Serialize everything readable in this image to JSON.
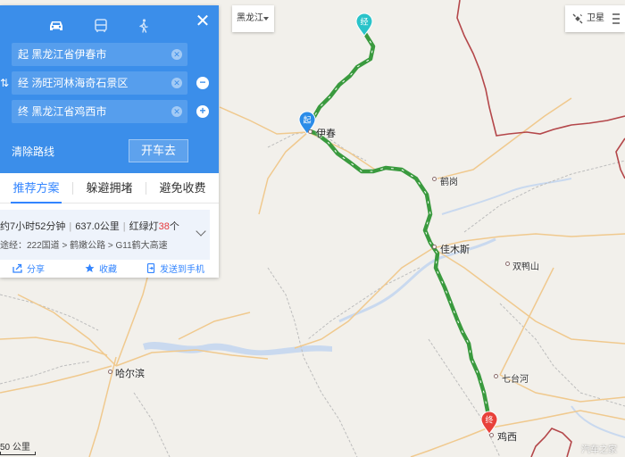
{
  "route_panel": {
    "modes": [
      {
        "name": "car-icon",
        "active": true
      },
      {
        "name": "bus-icon",
        "active": false
      },
      {
        "name": "walk-icon",
        "active": false
      }
    ],
    "start_field": "起  黑龙江省伊春市",
    "waypoint_field": "经  汤旺河林海奇石景区",
    "end_field": "终  黑龙江省鸡西市",
    "clear_route": "清除路线",
    "drive_button": "开车去",
    "tabs": [
      "推荐方案",
      "躲避拥堵",
      "避免收费"
    ],
    "summary": {
      "duration": "约7小时52分钟",
      "distance": "637.0公里",
      "lights_prefix": "红绿灯",
      "lights_count": "38",
      "lights_suffix": "个",
      "via": "途经：222国道 > 鹤嫩公路 > G11鹤大高速"
    },
    "actions": {
      "share": "分享",
      "favorite": "收藏",
      "send_to_phone": "发送到手机"
    }
  },
  "map_controls": {
    "region": "黑龙江",
    "satellite": "卫星",
    "scale": "50 公里"
  },
  "markers": {
    "start": "起",
    "waypoint": "经",
    "end": "终"
  },
  "places": {
    "yichun": "伊春",
    "hegang": "鹤岗",
    "jiamusi": "佳木斯",
    "shuangyashan": "双鸭山",
    "harbin": "哈尔滨",
    "qitaihe": "七台河",
    "jixi": "鸡西"
  },
  "watermark": "汽车之家",
  "colors": {
    "panel_blue": "#3b8eea",
    "route_green": "#3a9a3e",
    "start_marker": "#2b8ce8",
    "waypoint_marker": "#2ac3c9",
    "end_marker": "#e8413a",
    "border_red": "#b4474a"
  }
}
